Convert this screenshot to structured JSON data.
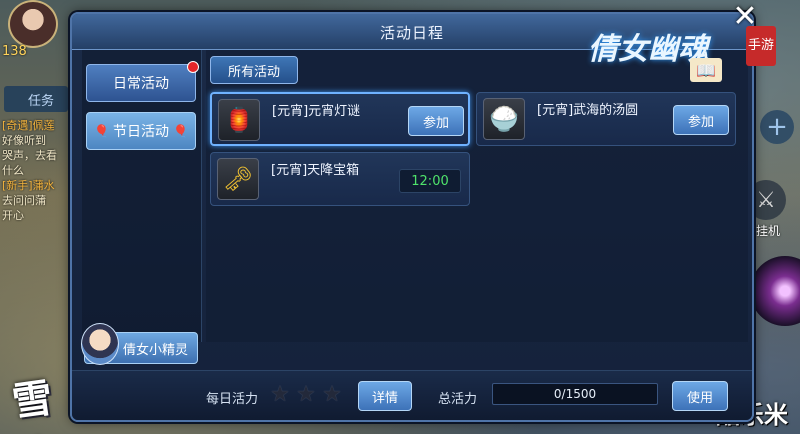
{
  "hud": {
    "level": "138",
    "task_tab": "任务",
    "quests": [
      {
        "tag": "[奇遇]佩莲",
        "text": "好像听到",
        "text2": "哭声，去看",
        "text3": "什么"
      },
      {
        "tag": "[新手]蒲水",
        "text": "去问问蒲",
        "text2": "开心"
      }
    ],
    "hang_up_label": "挂机",
    "game_logo": "倩女幽魂",
    "logo_seal": "手游",
    "corner_logo": "雪大",
    "week_icon": "周",
    "watermark": "酷乐米"
  },
  "panel": {
    "title": "活动日程",
    "close_icon": "close-icon",
    "side_tabs": [
      {
        "label": "日常活动",
        "active": true,
        "badge": true
      },
      {
        "label": "节日活动",
        "active": false,
        "badge": false
      }
    ],
    "sprite_button": "倩女小精灵",
    "filter_tab": "所有活动",
    "activities": [
      {
        "name": "[元宵]元宵灯谜",
        "action": "参加",
        "icon": "lantern-icon",
        "highlight": true
      },
      {
        "name": "[元宵]武海的汤圆",
        "action": "参加",
        "icon": "tangyuan-bowl-icon",
        "highlight": false
      },
      {
        "name": "[元宵]天降宝箱",
        "time": "12:00",
        "icon": "golden-key-icon",
        "highlight": false
      }
    ]
  },
  "footer": {
    "daily_vitality_label": "每日活力",
    "stars_filled": 0,
    "stars_total": 3,
    "detail_button": "详情",
    "total_vitality_label": "总活力",
    "total_vitality_value": 0,
    "total_vitality_max": 1500,
    "total_vitality_text": "0/1500",
    "use_button": "使用"
  },
  "colors": {
    "panel_bg": "#1b2b48",
    "accent_blue": "#4f7fc0",
    "timer_green": "#4fe36b",
    "badge_red": "#e3262a"
  }
}
